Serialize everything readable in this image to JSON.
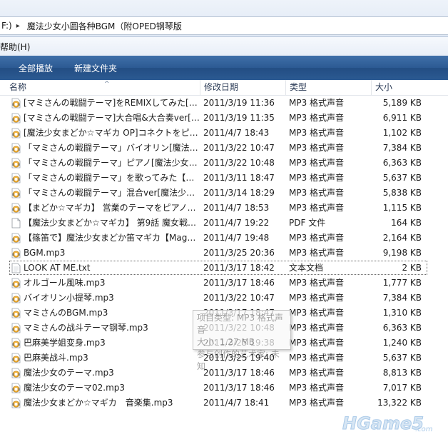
{
  "address": {
    "drive_fragment": "F:)",
    "chevron": "▸",
    "folder": "魔法少女小圆各种BGM（附OPED钢琴版"
  },
  "menubar": {
    "items": [
      {
        "label": "帮助(H)"
      }
    ]
  },
  "commandbar": {
    "play_all": "全部播放",
    "new_folder": "新建文件夹"
  },
  "columns": {
    "name": "名称",
    "date": "修改日期",
    "type": "类型",
    "size": "大小"
  },
  "files": [
    {
      "name": "[マミさんの戦闘テーマ]をREMIXしてみた[…",
      "date": "2011/3/19 11:36",
      "type": "MP3 格式声音",
      "size": "5,189 KB",
      "icon": "audio-file-icon"
    },
    {
      "name": "[マミさんの戦闘テーマ]大合唱&大合奏ver[…",
      "date": "2011/3/19 11:35",
      "type": "MP3 格式声音",
      "size": "6,911 KB",
      "icon": "audio-file-icon"
    },
    {
      "name": "[魔法少女まどか☆マギカ OP]コネクトをピ…",
      "date": "2011/4/7 18:43",
      "type": "MP3 格式声音",
      "size": "1,102 KB",
      "icon": "audio-file-icon"
    },
    {
      "name": "「マミさんの戦闘テーマ」バイオリン[魔法…",
      "date": "2011/3/22 10:47",
      "type": "MP3 格式声音",
      "size": "7,384 KB",
      "icon": "audio-file-icon"
    },
    {
      "name": "「マミさんの戦闘テーマ」ピアノ[魔法少女…",
      "date": "2011/3/22 10:48",
      "type": "MP3 格式声音",
      "size": "6,363 KB",
      "icon": "audio-file-icon"
    },
    {
      "name": "「マミさんの戦闘テーマ」を歌ってみた【…",
      "date": "2011/3/11 18:47",
      "type": "MP3 格式声音",
      "size": "5,637 KB",
      "icon": "audio-file-icon"
    },
    {
      "name": "「マミさんの戦闘テーマ」混合ver[魔法少…",
      "date": "2011/3/14 18:29",
      "type": "MP3 格式声音",
      "size": "5,838 KB",
      "icon": "audio-file-icon"
    },
    {
      "name": "【まどか☆マギカ】 営業のテーマをピアノ…",
      "date": "2011/4/7 18:53",
      "type": "MP3 格式声音",
      "size": "1,115 KB",
      "icon": "audio-file-icon"
    },
    {
      "name": "【魔法少女まどか☆マギカ】 第9話 魔女戦…",
      "date": "2011/4/7 19:22",
      "type": "PDF 文件",
      "size": "164 KB",
      "icon": "pdf-file-icon"
    },
    {
      "name": "【篠笛で】魔法少女まどか笛マギカ【Mag…",
      "date": "2011/4/7 19:48",
      "type": "MP3 格式声音",
      "size": "2,164 KB",
      "icon": "audio-file-icon"
    },
    {
      "name": "BGM.mp3",
      "date": "2011/3/25 20:36",
      "type": "MP3 格式声音",
      "size": "9,198 KB",
      "icon": "audio-file-icon"
    },
    {
      "name": "LOOK AT ME.txt",
      "date": "2011/3/17 18:42",
      "type": "文本文档",
      "size": "2 KB",
      "icon": "text-file-icon",
      "focused": true
    },
    {
      "name": "オルゴール風味.mp3",
      "date": "2011/3/17 18:46",
      "type": "MP3 格式声音",
      "size": "1,777 KB",
      "icon": "audio-file-icon"
    },
    {
      "name": "バイオリン小提琴.mp3",
      "date": "2011/3/22 10:47",
      "type": "MP3 格式声音",
      "size": "7,384 KB",
      "icon": "audio-file-icon"
    },
    {
      "name": "マミさんのBGM.mp3",
      "date": "2011/3/17 18:47",
      "type": "MP3 格式声音",
      "size": "1,310 KB",
      "icon": "audio-file-icon"
    },
    {
      "name": "マミさんの战斗テーマ钢琴.mp3",
      "date": "2011/3/22 10:48",
      "type": "MP3 格式声音",
      "size": "6,363 KB",
      "icon": "audio-file-icon"
    },
    {
      "name": "巴麻美学姐变身.mp3",
      "date": "2011/3/25 19:38",
      "type": "MP3 格式声音",
      "size": "1,240 KB",
      "icon": "audio-file-icon"
    },
    {
      "name": "巴麻美战斗.mp3",
      "date": "2011/3/25 19:40",
      "type": "MP3 格式声音",
      "size": "5,637 KB",
      "icon": "audio-file-icon"
    },
    {
      "name": "魔法少女のテーマ.mp3",
      "date": "2011/3/17 18:46",
      "type": "MP3 格式声音",
      "size": "8,813 KB",
      "icon": "audio-file-icon"
    },
    {
      "name": "魔法少女のテーマ02.mp3",
      "date": "2011/3/17 18:46",
      "type": "MP3 格式声音",
      "size": "7,017 KB",
      "icon": "audio-file-icon"
    },
    {
      "name": "魔法少女まどか☆マギカ　音楽集.mp3",
      "date": "2011/4/7 18:41",
      "type": "MP3 格式声音",
      "size": "13,322 KB",
      "icon": "audio-file-icon"
    }
  ],
  "tooltip": {
    "lines": [
      "项目类型: MP3 格式声音",
      "大小: 1.27 MB",
      "参与创作的艺术家: 未知"
    ]
  },
  "watermark": {
    "text": "HGame5",
    "suffix": ".com"
  },
  "colors": {
    "command_bar": "#2c5a93",
    "header_text": "#2a3a55",
    "watermark": "#a9c9e8"
  }
}
